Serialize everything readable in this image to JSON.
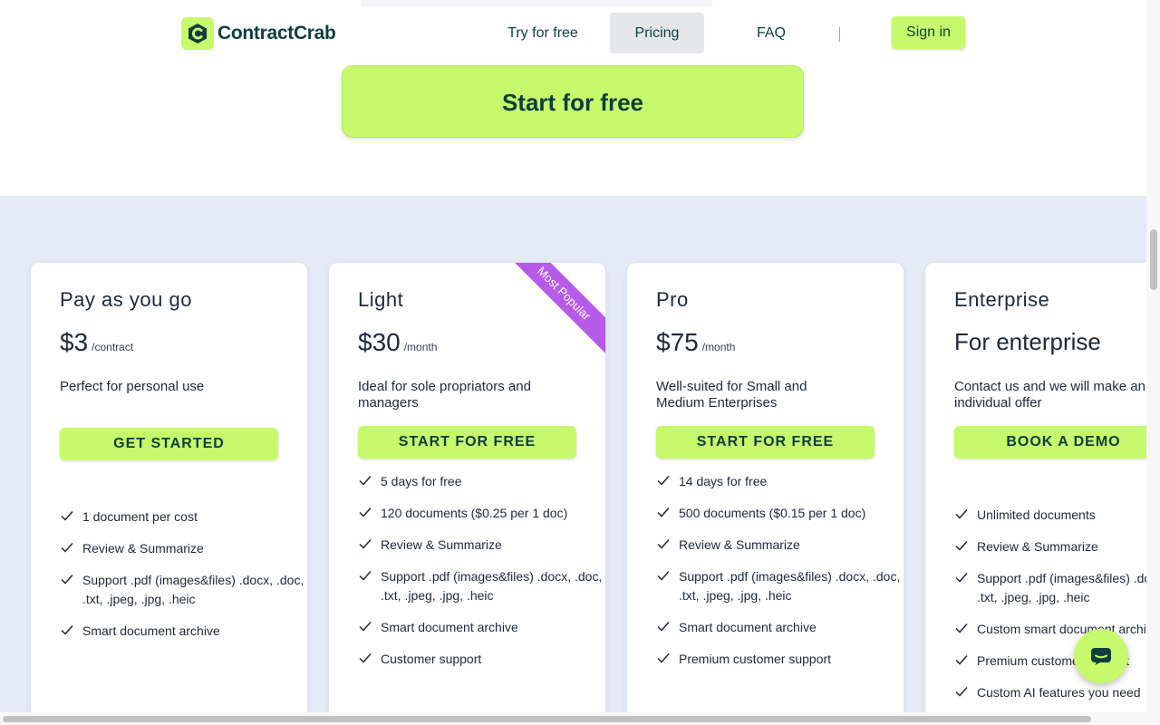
{
  "nav": {
    "logo_text": "ContractCrab",
    "try_label": "Try for free",
    "pricing_label": "Pricing",
    "faq_label": "FAQ",
    "signin_label": "Sign in"
  },
  "hero": {
    "cta_label": "Start for free"
  },
  "colors": {
    "accent": "#c6f96b",
    "brand_dark": "#0f3d3e",
    "ribbon": "#b65be8",
    "section_bg": "#e4eaf6"
  },
  "plans": [
    {
      "name": "Pay as you go",
      "price": "$3",
      "unit": "/contract",
      "description": "Perfect for personal use",
      "cta": "GET STARTED",
      "features": [
        "1 document per cost",
        "Review & Summarize",
        "Support .pdf (images&files) .docx, .doc, .txt, .jpeg, .jpg, .heic",
        "Smart document archive"
      ]
    },
    {
      "name": "Light",
      "price": "$30",
      "unit": "/month",
      "description": "Ideal for sole propriators and managers",
      "cta": "START FOR FREE",
      "ribbon": "Most Popular",
      "features": [
        "5 days for free",
        "120 documents ($0.25 per 1 doc)",
        "Review & Summarize",
        "Support .pdf (images&files) .docx, .doc, .txt, .jpeg, .jpg, .heic",
        "Smart document archive",
        "Customer support"
      ]
    },
    {
      "name": "Pro",
      "price": "$75",
      "unit": "/month",
      "description": "Well-suited for Small and Medium Enterprises",
      "cta": "START FOR FREE",
      "features": [
        "14 days for free",
        "500 documents ($0.15 per 1 doc)",
        "Review & Summarize",
        "Support .pdf (images&files) .docx, .doc, .txt, .jpeg, .jpg, .heic",
        "Smart document archive",
        "Premium customer support"
      ]
    },
    {
      "name": "Enterprise",
      "price": "For enterprise",
      "description": "Contact us and we will make an individual offer",
      "cta": "BOOK A DEMO",
      "features": [
        "Unlimited documents",
        "Review & Summarize",
        "Support .pdf (images&files) .docx, .doc, .txt, .jpeg, .jpg, .heic",
        "Custom smart document archive",
        "Premium customer support",
        "Custom AI features you need"
      ]
    }
  ],
  "icons": {
    "logo": "logo-mark-icon",
    "check": "check-icon",
    "chat": "chat-icon"
  }
}
